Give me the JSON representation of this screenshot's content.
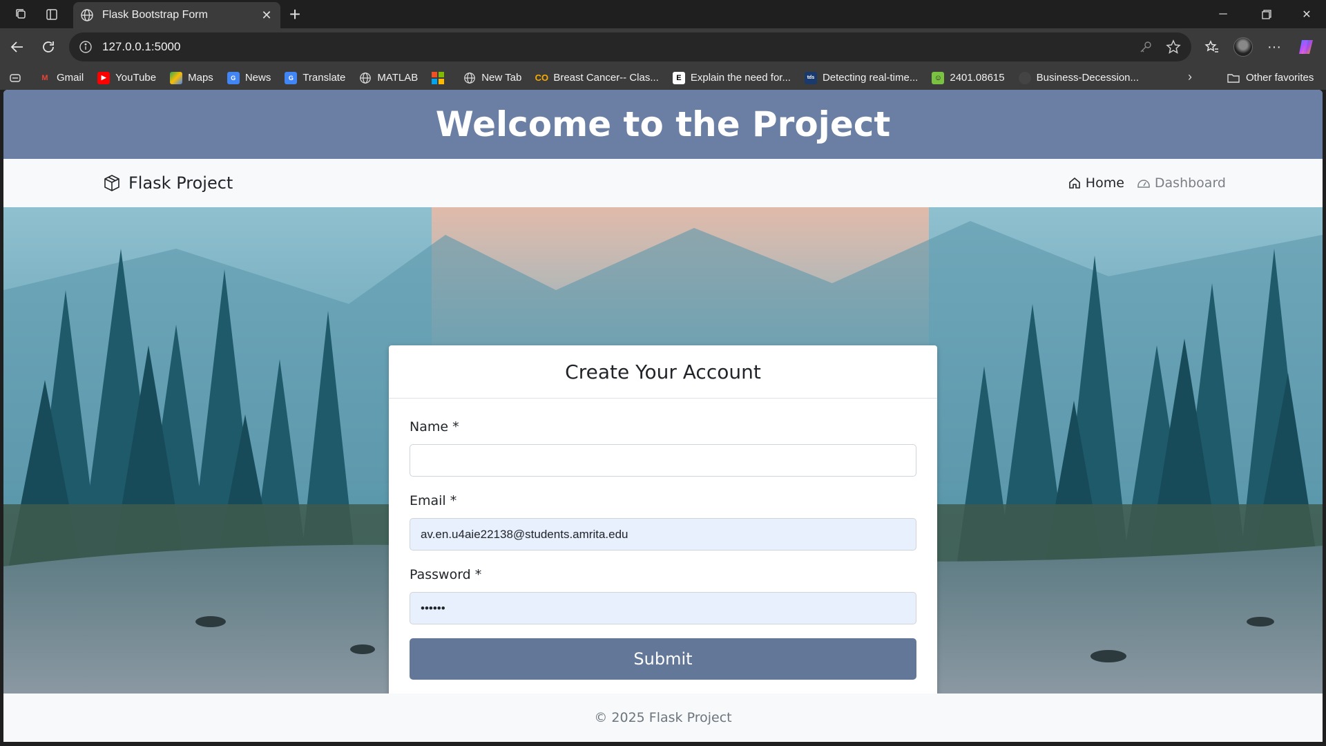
{
  "browser": {
    "tab": {
      "title": "Flask Bootstrap Form",
      "favicon": "globe-icon"
    },
    "address": {
      "url": "127.0.0.1:5000"
    },
    "bookmarks": [
      {
        "label": "Gmail",
        "icon": "gmail-icon",
        "color": "#ea4335"
      },
      {
        "label": "YouTube",
        "icon": "youtube-icon",
        "color": "#ff0000"
      },
      {
        "label": "Maps",
        "icon": "maps-icon",
        "color": "#34a853"
      },
      {
        "label": "News",
        "icon": "news-icon",
        "color": "#4285f4"
      },
      {
        "label": "Translate",
        "icon": "translate-icon",
        "color": "#4285f4"
      },
      {
        "label": "MATLAB",
        "icon": "globe-icon",
        "color": "#dddddd"
      },
      {
        "label": "",
        "icon": "microsoft-icon",
        "color": "#f25022"
      },
      {
        "label": "New Tab",
        "icon": "globe-icon",
        "color": "#dddddd"
      },
      {
        "label": "Breast Cancer-- Clas...",
        "icon": "colab-icon",
        "color": "#f9ab00"
      },
      {
        "label": "Explain the need for...",
        "icon": "e-icon",
        "color": "#ffffff"
      },
      {
        "label": "Detecting real-time...",
        "icon": "tds-icon",
        "color": "#1a3a6e"
      },
      {
        "label": "2401.08615",
        "icon": "smiley-icon",
        "color": "#7bc142"
      },
      {
        "label": "Business-Decession...",
        "icon": "github-icon",
        "color": "#444444"
      }
    ],
    "other_favorites": "Other favorites"
  },
  "page": {
    "header_title": "Welcome to the Project",
    "brand": "Flask Project",
    "nav": {
      "home": "Home",
      "dashboard": "Dashboard"
    },
    "form": {
      "title": "Create Your Account",
      "name_label": "Name *",
      "name_value": "",
      "email_label": "Email *",
      "email_value": "av.en.u4aie22138@students.amrita.edu",
      "password_label": "Password *",
      "password_value": "••••••",
      "submit_label": "Submit"
    },
    "footer": "© 2025 Flask Project"
  },
  "colors": {
    "header_bg": "#6a7fa3",
    "submit_bg": "#637899",
    "autofill_bg": "#e8f0fe"
  }
}
